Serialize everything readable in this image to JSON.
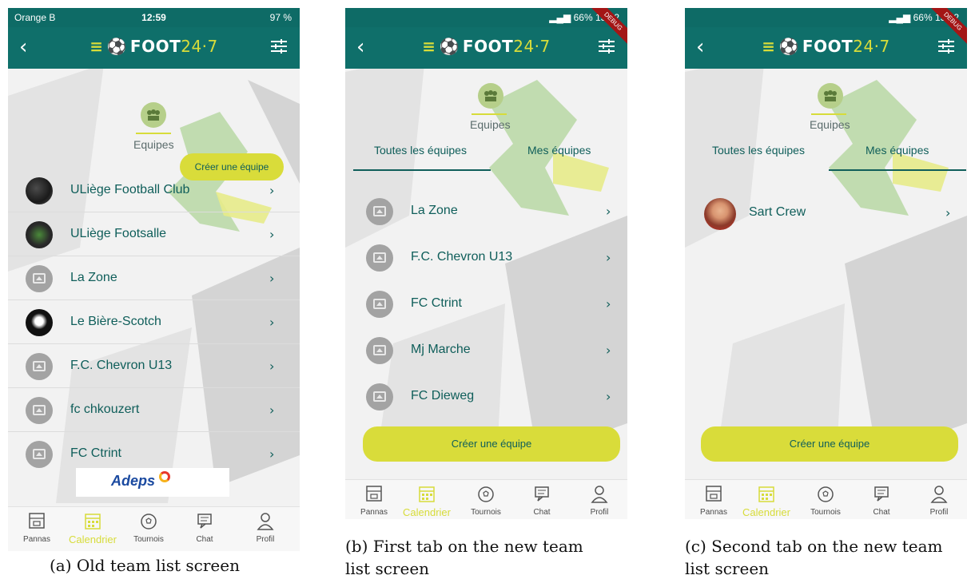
{
  "panels": [
    {
      "status": {
        "left": "Orange B",
        "time": "12:59",
        "right": "97 %"
      },
      "logo": {
        "text": "FOOT",
        "num": "24·7"
      },
      "section_title": "Equipes",
      "create_label": "Créer une équipe",
      "teams": [
        {
          "name": "ULiège Football Club",
          "avatar": "photo"
        },
        {
          "name": "ULiège Footsalle",
          "avatar": "photo"
        },
        {
          "name": "La Zone",
          "avatar": "placeholder"
        },
        {
          "name": "Le Bière-Scotch",
          "avatar": "photo"
        },
        {
          "name": "F.C. Chevron U13",
          "avatar": "placeholder"
        },
        {
          "name": "fc chkouzert",
          "avatar": "placeholder"
        },
        {
          "name": "FC Ctrint",
          "avatar": "placeholder"
        }
      ],
      "sponsor": "Adeps",
      "caption": "(a) Old team list screen"
    },
    {
      "status": {
        "right": "66%",
        "time": "13:02"
      },
      "logo": {
        "text": "FOOT",
        "num": "24·7"
      },
      "debug": "DEBUG",
      "section_title": "Equipes",
      "tabs": [
        "Toutes les équipes",
        "Mes équipes"
      ],
      "active_tab": 0,
      "teams": [
        {
          "name": "La Zone"
        },
        {
          "name": "F.C. Chevron U13"
        },
        {
          "name": "FC Ctrint"
        },
        {
          "name": "Mj Marche"
        },
        {
          "name": "FC Dieweg"
        }
      ],
      "create_label": "Créer une équipe",
      "caption_line1": "(b) First tab on the new team",
      "caption_line2": "list screen"
    },
    {
      "status": {
        "right": "66%",
        "time": "13:02"
      },
      "logo": {
        "text": "FOOT",
        "num": "24·7"
      },
      "debug": "DEBUG",
      "section_title": "Equipes",
      "tabs": [
        "Toutes les équipes",
        "Mes équipes"
      ],
      "active_tab": 1,
      "teams": [
        {
          "name": "Sart Crew"
        }
      ],
      "create_label": "Créer une équipe",
      "caption_line1": "(c) Second tab on the new team",
      "caption_line2": "list screen"
    }
  ],
  "nav": [
    "Pannas",
    "Calendrier",
    "Tournois",
    "Chat",
    "Profil"
  ],
  "nav_active": 1,
  "colors": {
    "appbar": "#0f6f6a",
    "accent": "#d7dc3a",
    "text": "#0f5e5a"
  }
}
